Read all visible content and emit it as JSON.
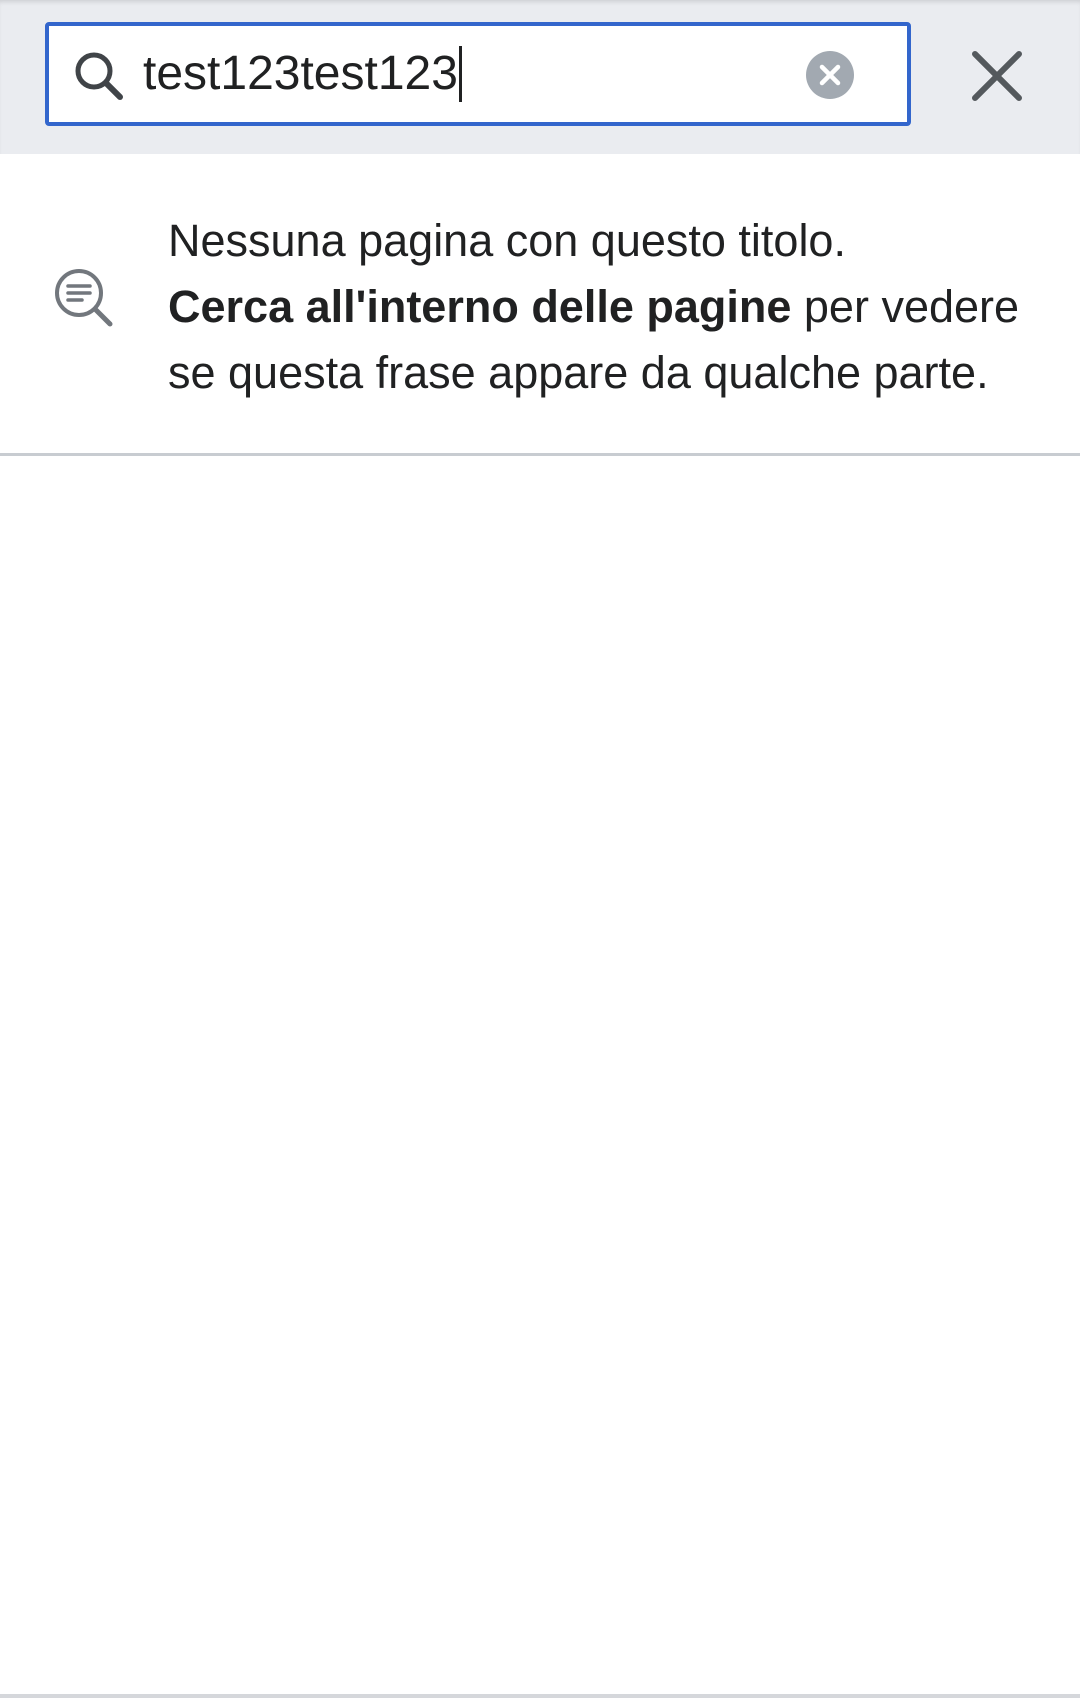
{
  "search": {
    "value": "test123test123",
    "icon": "search-icon",
    "clear_icon": "clear-circle-icon"
  },
  "header": {
    "close_icon": "close-icon"
  },
  "notice": {
    "icon": "search-in-text-icon",
    "message": "Nessuna pagina con questo titolo.",
    "link_label": "Cerca all'interno delle pagine",
    "suffix": "per vedere se questa frase appare da qualche parte."
  },
  "colors": {
    "accent": "#3366cc",
    "header_bg": "#eaecf0",
    "text": "#202122",
    "icon_gray": "#54595d",
    "clear_gray": "#a2a9b1",
    "divider": "#c8ccd1"
  }
}
